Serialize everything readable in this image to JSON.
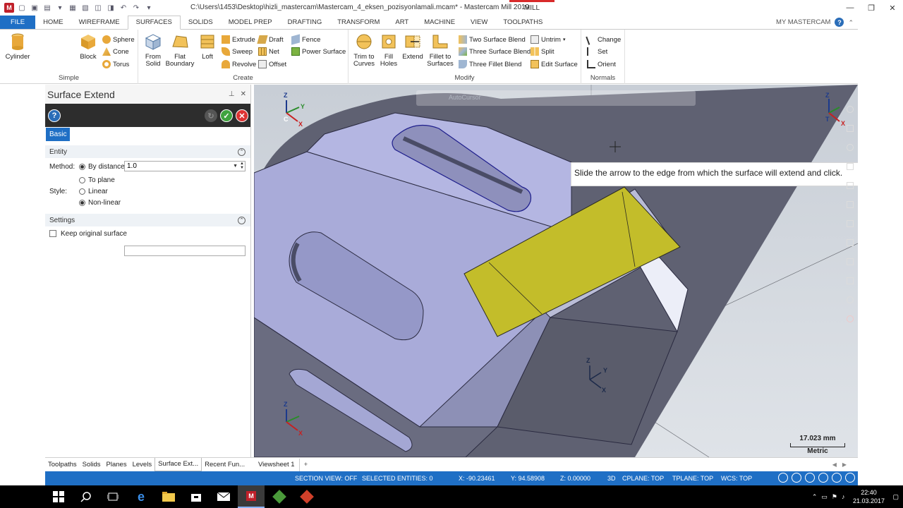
{
  "window": {
    "title": "C:\\Users\\1453\\Desktop\\hizli_mastercam\\Mastercam_4_eksen_pozisyonlamali.mcam* - Mastercam Mill 2019",
    "context_tab": "MILL"
  },
  "ribbon_tabs": [
    "FILE",
    "HOME",
    "WIREFRAME",
    "SURFACES",
    "SOLIDS",
    "MODEL PREP",
    "DRAFTING",
    "TRANSFORM",
    "ART",
    "MACHINE",
    "VIEW",
    "TOOLPATHS"
  ],
  "active_tab": "SURFACES",
  "my_mastercam": "MY MASTERCAM",
  "ribbon": {
    "simple": {
      "label": "Simple",
      "cylinder": "Cylinder",
      "block": "Block",
      "sphere": "Sphere",
      "cone": "Cone",
      "torus": "Torus"
    },
    "create": {
      "label": "Create",
      "from_solid": [
        "From",
        "Solid"
      ],
      "flat_boundary": [
        "Flat",
        "Boundary"
      ],
      "loft": "Loft",
      "extrude": "Extrude",
      "sweep": "Sweep",
      "revolve": "Revolve",
      "draft": "Draft",
      "net": "Net",
      "offset": "Offset",
      "fence": "Fence",
      "power_surface": "Power Surface"
    },
    "modify": {
      "label": "Modify",
      "trim_to_curves": [
        "Trim to",
        "Curves"
      ],
      "fill_holes": [
        "Fill",
        "Holes"
      ],
      "extend": "Extend",
      "fillet_to_surfaces": [
        "Fillet to",
        "Surfaces"
      ],
      "two_surface_blend": "Two Surface Blend",
      "three_surface_blend": "Three Surface Blend",
      "three_fillet_blend": "Three Fillet Blend",
      "untrim": "Untrim",
      "split": "Split",
      "edit_surface": "Edit Surface"
    },
    "normals": {
      "label": "Normals",
      "change": "Change",
      "set": "Set",
      "orient": "Orient"
    }
  },
  "panel": {
    "title": "Surface Extend",
    "tab": "Basic",
    "entity_section": "Entity",
    "method_label": "Method:",
    "method_options": [
      "By distance:",
      "To plane"
    ],
    "distance_value": "1.0",
    "style_label": "Style:",
    "style_options": [
      "Linear",
      "Non-linear"
    ],
    "settings_section": "Settings",
    "keep_original": "Keep original surface"
  },
  "manager_tabs": [
    "Toolpaths",
    "Solids",
    "Planes",
    "Levels",
    "Surface Ext...",
    "Recent Fun..."
  ],
  "active_manager_tab": "Surface Ext...",
  "viewport": {
    "prompt": "Slide the arrow to the edge from which the surface will extend and click.",
    "autocursor": "AutoCursor",
    "scale_value": "17.023 mm",
    "scale_unit": "Metric",
    "axis": {
      "x": "X",
      "y": "Y",
      "z": "Z",
      "t": "T",
      "c": "C"
    }
  },
  "viewsheet": {
    "tab": "Viewsheet 1",
    "add": "+"
  },
  "status": {
    "section_view": "SECTION VIEW: OFF",
    "selected": "SELECTED ENTITIES: 0",
    "x": "X:  -90.23461",
    "y": "Y:  94.58908",
    "z": "Z:  0.00000",
    "mode": "3D",
    "cplane": "CPLANE: TOP",
    "tplane": "TPLANE: TOP",
    "wcs": "WCS: TOP"
  },
  "taskbar": {
    "time": "22:40",
    "date": "21.03.2017"
  },
  "colors": {
    "accent": "#1f6fc5",
    "part_face": "#a9abd9",
    "part_dark": "#5e6070",
    "selected_surface": "#c3bd2a"
  }
}
